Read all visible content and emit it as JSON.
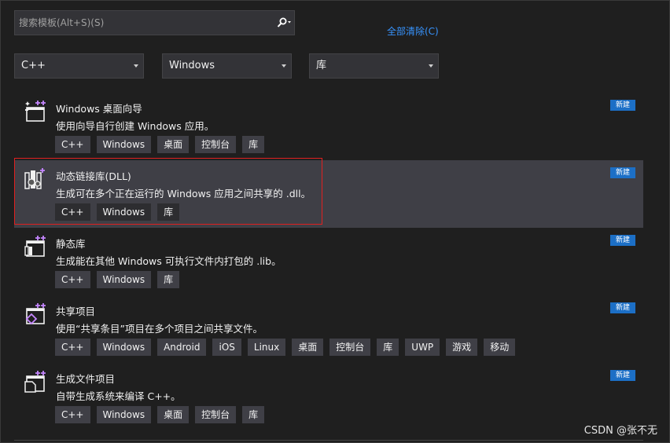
{
  "search": {
    "placeholder": "搜索模板(Alt+S)(S)"
  },
  "clear_all": "全部清除(C)",
  "filters": [
    {
      "value": "C++"
    },
    {
      "value": "Windows"
    },
    {
      "value": "库"
    }
  ],
  "badge": "新建",
  "templates": [
    {
      "icon": "windows-desktop-wizard-icon",
      "title": "Windows 桌面向导",
      "desc": "使用向导自行创建 Windows 应用。",
      "tags": [
        "C++",
        "Windows",
        "桌面",
        "控制台",
        "库"
      ]
    },
    {
      "icon": "dll-icon",
      "title": "动态链接库(DLL)",
      "desc": "生成可在多个正在运行的 Windows 应用之间共享的 .dll。",
      "tags": [
        "C++",
        "Windows",
        "库"
      ],
      "selected": true
    },
    {
      "icon": "static-library-icon",
      "title": "静态库",
      "desc": "生成能在其他 Windows 可执行文件内打包的 .lib。",
      "tags": [
        "C++",
        "Windows",
        "库"
      ]
    },
    {
      "icon": "shared-project-icon",
      "title": "共享项目",
      "desc": "使用“共享条目”项目在多个项目之间共享文件。",
      "tags": [
        "C++",
        "Windows",
        "Android",
        "iOS",
        "Linux",
        "桌面",
        "控制台",
        "库",
        "UWP",
        "游戏",
        "移动"
      ]
    },
    {
      "icon": "makefile-project-icon",
      "title": "生成文件项目",
      "desc": "自带生成系统来编译 C++。",
      "tags": [
        "C++",
        "Windows",
        "桌面",
        "控制台",
        "库"
      ]
    }
  ],
  "watermark": "CSDN @张不无",
  "colors": {
    "background": "#1f1f1f",
    "selected": "#3f3f46",
    "accent": "#3794ff",
    "badge": "#1c6fc6",
    "highlight": "#e02020"
  }
}
